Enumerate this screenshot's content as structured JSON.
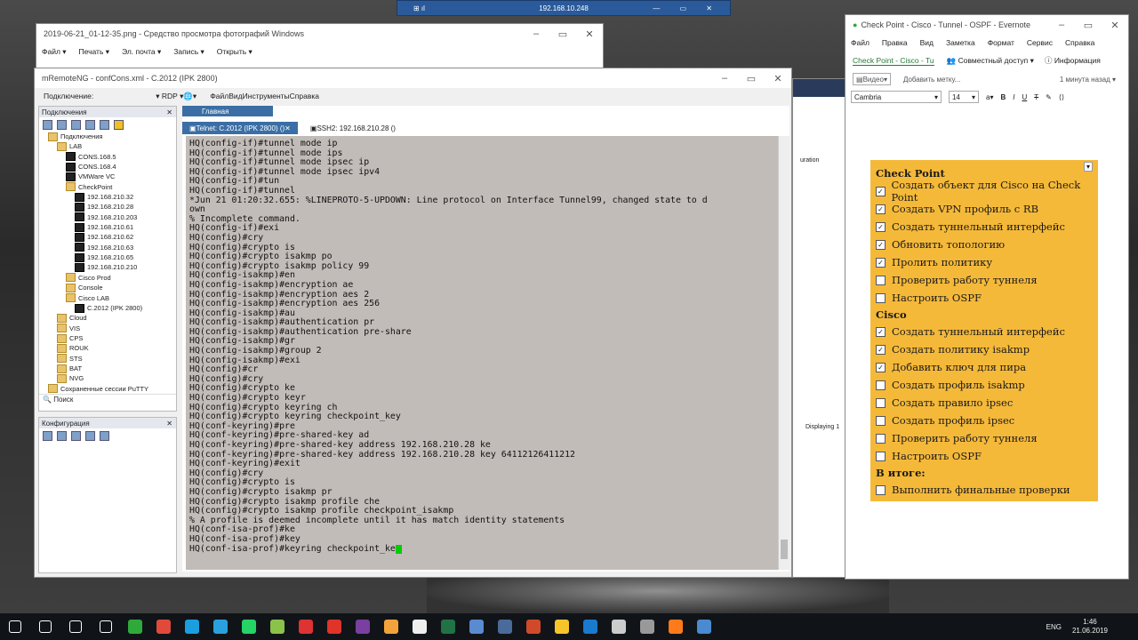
{
  "remote_bar": {
    "ip": "192.168.10.248",
    "left_icons": "⊞ ıl",
    "right_icons": "— ▭ ✕"
  },
  "photo_viewer": {
    "title": "2019-06-21_01-12-35.png - Средство просмотра фотографий Windows",
    "menu": [
      "Файл",
      "Печать",
      "Эл. почта",
      "Запись",
      "Открыть"
    ]
  },
  "mremote": {
    "title": "mRemoteNG - confCons.xml - C.2012 (IPK 2800)",
    "connect_label": "Подключение:",
    "rdp_label": "RDP",
    "menu": [
      "Файл",
      "Вид",
      "Инструменты",
      "Справка"
    ],
    "connections_panel": {
      "title": "Подключения",
      "tree": [
        {
          "label": "Подключения",
          "indent": 1,
          "type": "folder"
        },
        {
          "label": "LAB",
          "indent": 2,
          "type": "folder"
        },
        {
          "label": "CONS.168.5",
          "indent": 3,
          "type": "term"
        },
        {
          "label": "CONS.168.4",
          "indent": 3,
          "type": "term"
        },
        {
          "label": "VMWare VC",
          "indent": 3,
          "type": "term"
        },
        {
          "label": "CheckPoint",
          "indent": 3,
          "type": "folder"
        },
        {
          "label": "192.168.210.32",
          "indent": 4,
          "type": "term"
        },
        {
          "label": "192.168.210.28",
          "indent": 4,
          "type": "term"
        },
        {
          "label": "192.168.210.203",
          "indent": 4,
          "type": "term"
        },
        {
          "label": "192.168.210.61",
          "indent": 4,
          "type": "term"
        },
        {
          "label": "192.168.210.62",
          "indent": 4,
          "type": "term"
        },
        {
          "label": "192.168.210.63",
          "indent": 4,
          "type": "term"
        },
        {
          "label": "192.168.210.65",
          "indent": 4,
          "type": "term"
        },
        {
          "label": "192.168.210.210",
          "indent": 4,
          "type": "term"
        },
        {
          "label": "Cisco Prod",
          "indent": 3,
          "type": "folder"
        },
        {
          "label": "Console",
          "indent": 3,
          "type": "folder"
        },
        {
          "label": "Cisco LAB",
          "indent": 3,
          "type": "folder"
        },
        {
          "label": "C.2012 (IPK 2800)",
          "indent": 4,
          "type": "term"
        },
        {
          "label": "Cloud",
          "indent": 2,
          "type": "folder"
        },
        {
          "label": "VIS",
          "indent": 2,
          "type": "folder"
        },
        {
          "label": "CPS",
          "indent": 2,
          "type": "folder"
        },
        {
          "label": "ROUK",
          "indent": 2,
          "type": "folder"
        },
        {
          "label": "STS",
          "indent": 2,
          "type": "folder"
        },
        {
          "label": "BAT",
          "indent": 2,
          "type": "folder"
        },
        {
          "label": "NVG",
          "indent": 2,
          "type": "folder"
        },
        {
          "label": "Сохраненные сессии PuTTY",
          "indent": 1,
          "type": "folder"
        }
      ],
      "search": "Поиск"
    },
    "config_panel": {
      "title": "Конфигурация"
    },
    "main_tab": "Главная",
    "sessions": [
      {
        "label": "Telnet: C.2012 (IPK 2800) ()",
        "active": true
      },
      {
        "label": "SSH2: 192.168.210.28 ()",
        "active": false
      }
    ],
    "console_lines": [
      "HQ(config-if)#tunnel mode ip",
      "HQ(config-if)#tunnel mode ips",
      "HQ(config-if)#tunnel mode ipsec ip",
      "HQ(config-if)#tunnel mode ipsec ipv4",
      "HQ(config-if)#tun",
      "HQ(config-if)#tunnel",
      "*Jun 21 01:20:32.655: %LINEPROTO-5-UPDOWN: Line protocol on Interface Tunnel99, changed state to d",
      "own",
      "% Incomplete command.",
      "",
      "HQ(config-if)#exi",
      "HQ(config)#cry",
      "HQ(config)#crypto is",
      "HQ(config)#crypto isakmp po",
      "HQ(config)#crypto isakmp policy 99",
      "HQ(config-isakmp)#en",
      "HQ(config-isakmp)#encryption ae",
      "HQ(config-isakmp)#encryption aes 2",
      "HQ(config-isakmp)#encryption aes 256",
      "HQ(config-isakmp)#au",
      "HQ(config-isakmp)#authentication pr",
      "HQ(config-isakmp)#authentication pre-share",
      "HQ(config-isakmp)#gr",
      "HQ(config-isakmp)#group 2",
      "HQ(config-isakmp)#exi",
      "HQ(config)#cr",
      "HQ(config)#cry",
      "HQ(config)#crypto ke",
      "HQ(config)#crypto keyr",
      "HQ(config)#crypto keyring ch",
      "HQ(config)#crypto keyring checkpoint_key",
      "HQ(conf-keyring)#pre",
      "HQ(conf-keyring)#pre-shared-key ad",
      "HQ(conf-keyring)#pre-shared-key address 192.168.210.28 ke",
      "HQ(conf-keyring)#pre-shared-key address 192.168.210.28 key 64112126411212",
      "HQ(conf-keyring)#exit",
      "HQ(config)#cry",
      "HQ(config)#crypto is",
      "HQ(config)#crypto isakmp pr",
      "HQ(config)#crypto isakmp profile che",
      "HQ(config)#crypto isakmp profile checkpoint_isakmp",
      "% A profile is deemed incomplete until it has match identity statements",
      "HQ(conf-isa-prof)#ke",
      "HQ(conf-isa-prof)#key",
      "HQ(conf-isa-prof)#keyring checkpoint_ke"
    ]
  },
  "bg_window": {
    "labels": [
      "uration",
      "Displaying 1"
    ]
  },
  "evernote": {
    "title": "Check Point - Cisco - Tunnel - OSPF - Evernote",
    "menu": [
      "Файл",
      "Правка",
      "Вид",
      "Заметка",
      "Формат",
      "Сервис",
      "Справка"
    ],
    "note_tab": "Check Point - Cisco - Tu",
    "share": "Совместный доступ",
    "info": "Информация",
    "notebook": "Видео",
    "tags_placeholder": "Добавить метку...",
    "updated": "1 минута назад",
    "font": "Cambria",
    "font_size": "14",
    "note": {
      "sections": [
        {
          "title": "Check Point",
          "items": [
            {
              "text": "Создать объект для Cisco на Check Point",
              "checked": true
            },
            {
              "text": "Создать VPN профиль с RB",
              "checked": true
            },
            {
              "text": "Создать туннельный интерфейс",
              "checked": true
            },
            {
              "text": "Обновить топологию",
              "checked": true
            },
            {
              "text": "Пролить политику",
              "checked": true
            },
            {
              "text": "Проверить работу туннеля",
              "checked": false
            },
            {
              "text": "Настроить OSPF",
              "checked": false
            }
          ]
        },
        {
          "title": "Cisco",
          "items": [
            {
              "text": "Создать туннельный интерфейс",
              "checked": true
            },
            {
              "text": "Создать политику isakmp",
              "checked": true
            },
            {
              "text": "Добавить ключ для пира",
              "checked": true
            },
            {
              "text": "Создать профиль isakmp",
              "checked": false
            },
            {
              "text": "Создать правило ipsec",
              "checked": false
            },
            {
              "text": "Создать профиль ipsec",
              "checked": false
            },
            {
              "text": "Проверить работу туннеля",
              "checked": false
            },
            {
              "text": "Настроить OSPF",
              "checked": false
            }
          ]
        },
        {
          "title": "В итоге:",
          "items": [
            {
              "text": "Выполнить финальные проверки",
              "checked": false
            }
          ]
        }
      ]
    }
  },
  "taskbar": {
    "lang": "ENG",
    "time": "1:46",
    "date": "21.06.2019",
    "apps": [
      "start",
      "search",
      "taskview",
      "terminal",
      "chrome-green",
      "chrome",
      "skype",
      "telegram",
      "whatsapp",
      "notepadpp",
      "filezilla",
      "opera",
      "onenote",
      "search-app",
      "mremote",
      "excel",
      "keepass",
      "vpn",
      "pdf",
      "chrome-white",
      "mail",
      "desktop",
      "snip",
      "firefox",
      "rdp"
    ],
    "app_colors": [
      "#ffffff",
      "#ffffff",
      "#ffffff",
      "#ffffff",
      "#2faa3a",
      "#e04a3a",
      "#1a9ee0",
      "#2aa1de",
      "#25d366",
      "#8bc34a",
      "#d33",
      "#e0332a",
      "#7a3fa0",
      "#f2a23a",
      "#eeeeee",
      "#217346",
      "#5a8ad0",
      "#4a6a9a",
      "#d04a2a",
      "#f7c52a",
      "#1a7ad0",
      "#cccccc",
      "#999999",
      "#ff7a1a",
      "#4a8ad0"
    ]
  }
}
